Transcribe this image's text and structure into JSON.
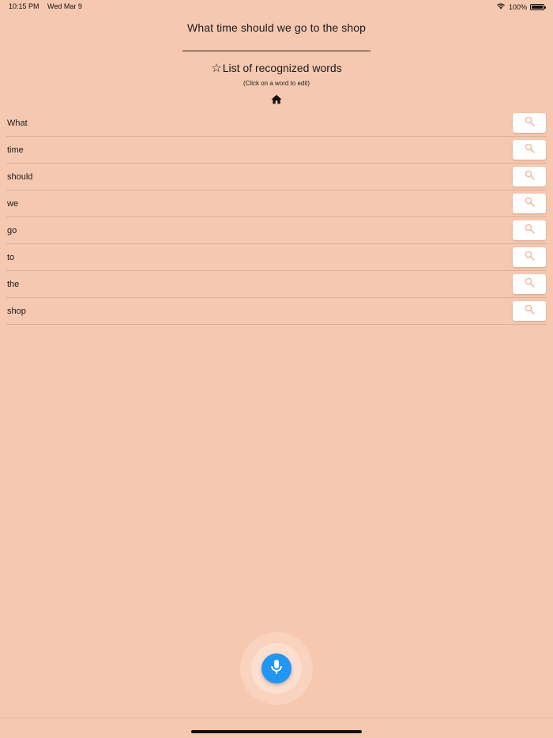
{
  "status_bar": {
    "time": "10:15 PM",
    "date": "Wed Mar 9",
    "battery_percent": "100%",
    "battery_level": 1.0,
    "wifi_icon": "wifi-icon",
    "battery_icon": "battery-icon"
  },
  "sentence": "What time should we go to the shop",
  "list": {
    "title": "List of recognized words",
    "title_icon": "star-outline-icon",
    "hint": "(Click on a word to edit)",
    "home_icon": "home-icon",
    "search_icon": "search-icon",
    "words": [
      {
        "text": "What"
      },
      {
        "text": "time"
      },
      {
        "text": "should"
      },
      {
        "text": "we"
      },
      {
        "text": "go"
      },
      {
        "text": "to"
      },
      {
        "text": "the"
      },
      {
        "text": "shop"
      }
    ]
  },
  "mic_button": {
    "icon": "microphone-icon",
    "color": "#2196f3"
  },
  "colors": {
    "background": "#f6c8b0",
    "accent": "#2196f3",
    "search_icon": "#f0b79c"
  }
}
